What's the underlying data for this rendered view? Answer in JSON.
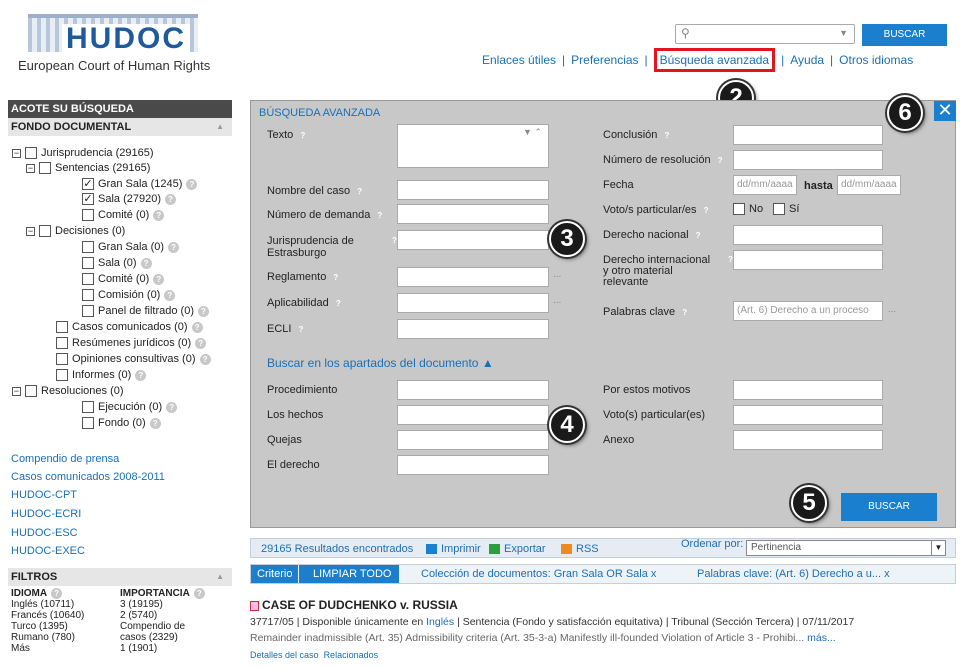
{
  "header": {
    "brand": "HUDOC",
    "brand_sub": "European Court of Human Rights",
    "search_placeholder": "",
    "search_button": "BUSCAR",
    "nav": [
      "Enlaces útiles",
      "Preferencias",
      "Búsqueda avanzada",
      "Ayuda",
      "Otros idiomas"
    ],
    "separator": "|"
  },
  "sidebar": {
    "title": "ACOTE SU BÚSQUEDA",
    "section": "FONDO DOCUMENTAL",
    "tree": [
      {
        "label": "Jurisprudencia (29165)",
        "checked": false
      },
      {
        "label": "Sentencias (29165)",
        "checked": false
      },
      {
        "label": "Gran Sala (1245)",
        "checked": true
      },
      {
        "label": "Sala (27920)",
        "checked": true
      },
      {
        "label": "Comité (0)",
        "checked": false
      },
      {
        "label": "Decisiones (0)",
        "checked": false
      },
      {
        "label": "Gran Sala (0)",
        "checked": false
      },
      {
        "label": "Sala (0)",
        "checked": false
      },
      {
        "label": "Comité (0)",
        "checked": false
      },
      {
        "label": "Comisión (0)",
        "checked": false
      },
      {
        "label": "Panel de filtrado (0)",
        "checked": false
      },
      {
        "label": "Casos comunicados (0)",
        "checked": false
      },
      {
        "label": "Resúmenes jurídicos (0)",
        "checked": false
      },
      {
        "label": "Opiniones consultivas (0)",
        "checked": false
      },
      {
        "label": "Informes (0)",
        "checked": false
      },
      {
        "label": "Resoluciones (0)",
        "checked": false
      },
      {
        "label": "Ejecución (0)",
        "checked": false
      },
      {
        "label": "Fondo (0)",
        "checked": false
      }
    ],
    "expander": "−",
    "checkmark": "✓",
    "links": [
      "Compendio de prensa",
      "Casos comunicados 2008-2011",
      "HUDOC-CPT",
      "HUDOC-ECRI",
      "HUDOC-ESC",
      "HUDOC-EXEC"
    ],
    "filters_title": "FILTROS",
    "idioma_title": "IDIOMA",
    "idioma": [
      "Inglés (10711)",
      "Francés (10640)",
      "Turco (1395)",
      "Rumano (780)",
      "Más"
    ],
    "importancia_title": "IMPORTANCIA",
    "importancia": [
      "3 (19195)",
      "2 (5740)",
      "Compendio de",
      "casos (2329)",
      "1 (1901)"
    ]
  },
  "panel": {
    "title": "BÚSQUEDA AVANZADA",
    "left_labels": [
      "Texto",
      "Nombre del caso",
      "Número de demanda",
      "Jurisprudencia de Estrasburgo",
      "Reglamento",
      "Aplicabilidad",
      "ECLI"
    ],
    "right_labels": [
      "Conclusión",
      "Número de resolución",
      "Fecha",
      "Voto/s particular/es",
      "Derecho nacional",
      "Derecho internacional y otro material relevante",
      "Palabras clave"
    ],
    "fecha_placeholder": "dd/mm/aaaa",
    "hasta": "hasta",
    "no": "No",
    "si": "Sí",
    "palabras_value": "(Art. 6) Derecho a un proceso",
    "ellipsis": "...",
    "section_link": "Buscar en los apartados del documento",
    "section_left": [
      "Procedimiento",
      "Los hechos",
      "Quejas",
      "El derecho"
    ],
    "section_right": [
      "Por estos motivos",
      "Voto(s) particular(es)",
      "Anexo"
    ],
    "search_button": "BUSCAR",
    "close": "✕",
    "badges": [
      "2",
      "3",
      "4",
      "5",
      "6"
    ]
  },
  "results": {
    "count": "29165 Resultados encontrados",
    "imprimir": "Imprimir",
    "exportar": "Exportar",
    "rss": "RSS",
    "ordenar": "Ordenar por:",
    "sort_value": "Pertinencia",
    "criterio": "Criterio",
    "limpiar": "LIMPIAR TODO",
    "chips": [
      "Colección de documentos: Gran Sala OR Sala   x",
      "Palabras clave: (Art. 6) Derecho a u...   x"
    ],
    "case_title": "CASE OF DUDCHENKO v. RUSSIA",
    "case_meta_1": "37717/05  |  Disponible únicamente en",
    "case_meta_lang": "Inglés",
    "case_meta_2": "|  Sentencia (Fondo y satisfacción equitativa)  |  Tribunal (Sección Tercera)  |  07/11/2017",
    "case_summary": "Remainder inadmissible (Art. 35) Admissibility criteria (Art. 35-3-a) Manifestly ill-founded Violation of Article 3 - Prohibi...",
    "mas": "más...",
    "detalles": "Detalles del caso",
    "relacionados": "Relacionados"
  },
  "colors": {
    "accent": "#1b7fcf",
    "highlight": "#e2141e",
    "panel_bg": "#c8c8c8"
  }
}
